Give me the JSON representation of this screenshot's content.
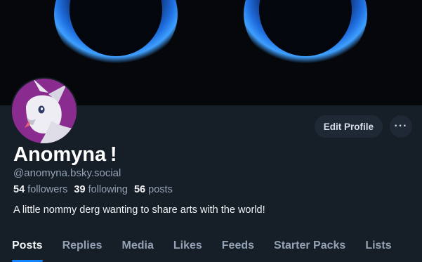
{
  "profile": {
    "display_name": "Anomyna !",
    "handle": "@anomyna.bsky.social",
    "followers_count": "54",
    "followers_label": "followers",
    "following_count": "39",
    "following_label": "following",
    "posts_count": "56",
    "posts_label": "posts",
    "bio": "A little nommy derg wanting to share arts with the world!"
  },
  "actions": {
    "edit_label": "Edit Profile",
    "more_icon": "ellipsis-icon"
  },
  "tabs": [
    {
      "label": "Posts",
      "active": true
    },
    {
      "label": "Replies"
    },
    {
      "label": "Media"
    },
    {
      "label": "Likes"
    },
    {
      "label": "Feeds"
    },
    {
      "label": "Starter Packs"
    },
    {
      "label": "Lists"
    }
  ],
  "colors": {
    "background": "#161e27",
    "accent": "#1083fe",
    "muted_text": "#93a2b4",
    "button_bg": "#1e2935",
    "avatar_bg": "#8a2c8f"
  }
}
